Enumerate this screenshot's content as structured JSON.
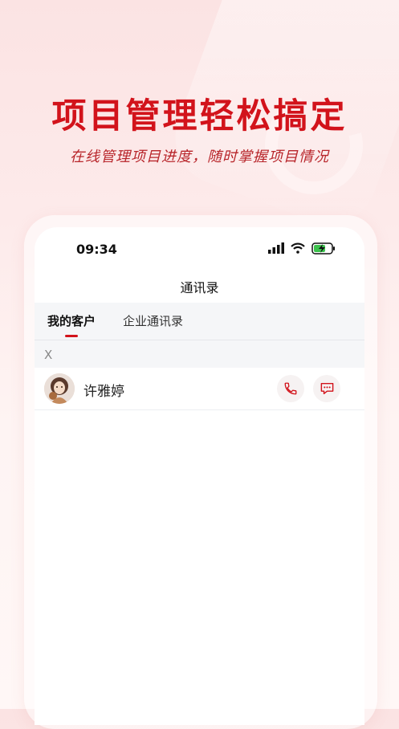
{
  "banner": {
    "headline": "项目管理轻松搞定",
    "subline": "在线管理项目进度，随时掌握项目情况"
  },
  "status_bar": {
    "time": "09:34",
    "icons": [
      "signal-icon",
      "wifi-icon",
      "battery-charging-icon"
    ]
  },
  "nav": {
    "title": "通讯录"
  },
  "tabs": [
    {
      "label": "我的客户",
      "active": true
    },
    {
      "label": "企业通讯录",
      "active": false
    }
  ],
  "contacts": {
    "section_letter": "X",
    "items": [
      {
        "name": "许雅婷",
        "actions": [
          "phone-icon",
          "message-icon"
        ]
      }
    ]
  },
  "colors": {
    "accent": "#d2131b",
    "background": "#fbe3e3"
  }
}
